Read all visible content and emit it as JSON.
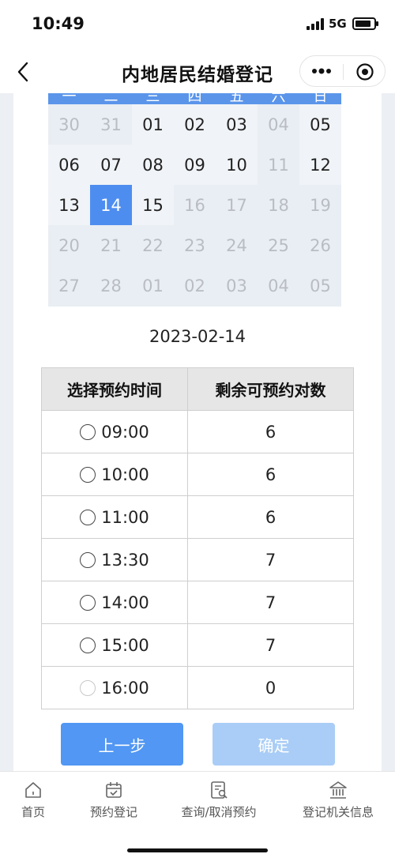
{
  "status_bar": {
    "time": "10:49",
    "network": "5G",
    "battery_level": 0.85
  },
  "nav": {
    "title": "内地居民结婚登记"
  },
  "calendar": {
    "weekdays": [
      "一",
      "二",
      "三",
      "四",
      "五",
      "六",
      "日"
    ],
    "days": [
      [
        "30",
        "31",
        "01",
        "02",
        "03",
        "04",
        "05"
      ],
      [
        "06",
        "07",
        "08",
        "09",
        "10",
        "11",
        "12"
      ],
      [
        "13",
        "14",
        "15",
        "16",
        "17",
        "18",
        "19"
      ],
      [
        "20",
        "21",
        "22",
        "23",
        "24",
        "25",
        "26"
      ],
      [
        "27",
        "28",
        "01",
        "02",
        "03",
        "04",
        "05"
      ]
    ],
    "available_days": [
      "01",
      "02",
      "03",
      "05",
      "06",
      "07",
      "08",
      "09",
      "10",
      "12",
      "13",
      "15"
    ],
    "selected_day": "14"
  },
  "selected_date": "2023-02-14",
  "table": {
    "headers": [
      "选择预约时间",
      "剩余可预约对数"
    ],
    "rows": [
      {
        "time": "09:00",
        "remaining": "6"
      },
      {
        "time": "10:00",
        "remaining": "6"
      },
      {
        "time": "11:00",
        "remaining": "6"
      },
      {
        "time": "13:30",
        "remaining": "7"
      },
      {
        "time": "14:00",
        "remaining": "7"
      },
      {
        "time": "15:00",
        "remaining": "7"
      },
      {
        "time": "16:00",
        "remaining": "0"
      }
    ]
  },
  "buttons": {
    "prev": "上一步",
    "confirm": "确定"
  },
  "tab_bar": {
    "items": [
      {
        "label": "首页",
        "icon": "home-icon"
      },
      {
        "label": "预约登记",
        "icon": "calendar-icon"
      },
      {
        "label": "查询/取消预约",
        "icon": "search-document-icon"
      },
      {
        "label": "登记机关信息",
        "icon": "government-building-icon"
      }
    ]
  },
  "colors": {
    "accent": "#4e8df0",
    "button_primary": "#5197f3",
    "button_disabled": "#a9cdf6",
    "calendar_bg": "#e9eef4"
  }
}
